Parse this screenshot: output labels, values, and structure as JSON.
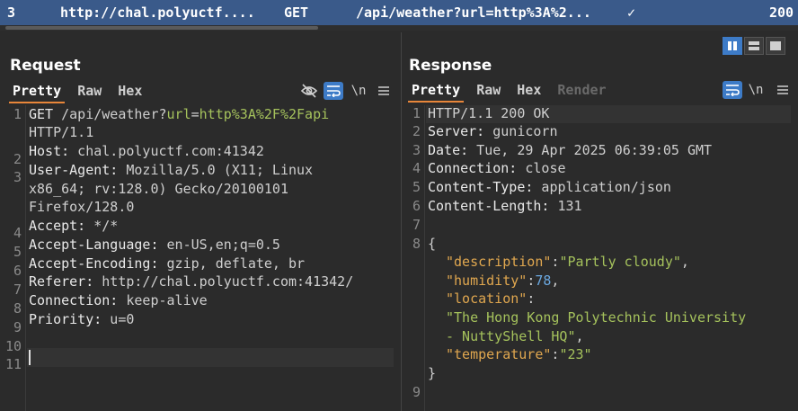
{
  "history": {
    "number": "3",
    "host": "http://chal.polyuctf....",
    "method": "GET",
    "url": "/api/weather?url=http%3A%2...",
    "check": "✓",
    "status": "200"
  },
  "layout": {
    "options": [
      "split-horizontal",
      "split-vertical",
      "single"
    ],
    "active": "split-horizontal"
  },
  "request": {
    "title": "Request",
    "tabs": [
      "Pretty",
      "Raw",
      "Hex"
    ],
    "active_tab": "Pretty",
    "newline_icon": "\\n",
    "gutter": [
      "1",
      "",
      "2",
      "3",
      "",
      "",
      "4",
      "5",
      "6",
      "7",
      "8",
      "9",
      "10",
      "11"
    ],
    "lines": {
      "l1_method": "GET ",
      "l1_path": "/api/weather?",
      "l1_param_key": "url",
      "l1_eq": "=",
      "l1_param_val": "http%3A%2F%2Fapi",
      "l1b": "HTTP/1.1",
      "l2_key": "Host:",
      "l2_val": " chal.polyuctf.com:41342",
      "l3_key": "User-Agent:",
      "l3_val": " Mozilla/5.0 (X11; Linux",
      "l3b": "x86_64; rv:128.0) Gecko/20100101",
      "l3c": "Firefox/128.0",
      "l4_key": "Accept:",
      "l4_val": " */*",
      "l5_key": "Accept-Language:",
      "l5_val": " en-US,en;q=0.5",
      "l6_key": "Accept-Encoding:",
      "l6_val": " gzip, deflate, br",
      "l7_key": "Referer:",
      "l7_val": " http://chal.polyuctf.com:41342/",
      "l8_key": "Connection:",
      "l8_val": " keep-alive",
      "l9_key": "Priority:",
      "l9_val": " u=0"
    }
  },
  "response": {
    "title": "Response",
    "tabs": [
      "Pretty",
      "Raw",
      "Hex",
      "Render"
    ],
    "active_tab": "Pretty",
    "newline_icon": "\\n",
    "gutter": [
      "1",
      "2",
      "3",
      "4",
      "5",
      "6",
      "7",
      "8",
      "",
      "",
      "",
      "",
      "",
      "",
      "9"
    ],
    "lines": {
      "l1": "HTTP/1.1 200 OK",
      "l2_key": "Server:",
      "l2_val": " gunicorn",
      "l3_key": "Date:",
      "l3_val": " Tue, 29 Apr 2025 06:39:05 GMT",
      "l4_key": "Connection:",
      "l4_val": " close",
      "l5_key": "Content-Type:",
      "l5_val": " application/json",
      "l6_key": "Content-Length:",
      "l6_val": " 131",
      "brace_open": "{",
      "desc_key": "\"description\"",
      "desc_colon": ":",
      "desc_val": "\"Partly cloudy\"",
      "comma": ",",
      "hum_key": "\"humidity\"",
      "hum_val": "78",
      "loc_key": "\"location\"",
      "loc_val_a": "\"The Hong Kong Polytechnic University",
      "loc_val_b": "- NuttyShell HQ\"",
      "temp_key": "\"temperature\"",
      "temp_val": "\"23\"",
      "brace_close": "}"
    }
  },
  "colors": {
    "accent": "#3d7bc7",
    "tab_underline": "#e8863a",
    "history_bg": "#3a5a8a"
  }
}
